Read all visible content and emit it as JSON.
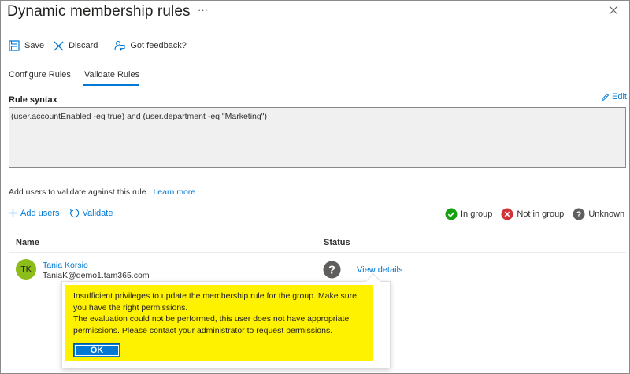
{
  "window": {
    "title": "Dynamic membership rules",
    "more_label": "···"
  },
  "toolbar": {
    "save_label": "Save",
    "discard_label": "Discard",
    "feedback_label": "Got feedback?"
  },
  "tabs": [
    {
      "label": "Configure Rules",
      "active": false
    },
    {
      "label": "Validate Rules",
      "active": true
    }
  ],
  "rule_syntax": {
    "label": "Rule syntax",
    "edit_label": "Edit",
    "value": "(user.accountEnabled -eq true) and (user.department -eq \"Marketing\")"
  },
  "validate": {
    "description": "Add users to validate against this rule.",
    "learn_more": "Learn more",
    "add_users_label": "Add users",
    "validate_label": "Validate"
  },
  "legend": {
    "in_group": "In group",
    "not_in_group": "Not in group",
    "unknown": "Unknown"
  },
  "table": {
    "columns": [
      "Name",
      "Status"
    ],
    "rows": [
      {
        "initials": "TK",
        "name": "Tania Korsio",
        "email": "TaniaK@demo1.tam365.com",
        "status_icon": "question-icon",
        "details_link": "View details"
      }
    ]
  },
  "callout": {
    "line1": "Insufficient privileges to update the membership rule for the group. Make sure you have the right permissions.",
    "line2": "The evaluation could not be performed, this user does not have appropriate permissions. Please contact your administrator to request permissions.",
    "ok_label": "OK"
  },
  "colors": {
    "accent": "#0078d4",
    "in_group": "#13a10e",
    "not_in_group": "#d13438",
    "unknown": "#605e5c",
    "highlight": "#fff200",
    "avatar": "#8cbd18"
  }
}
